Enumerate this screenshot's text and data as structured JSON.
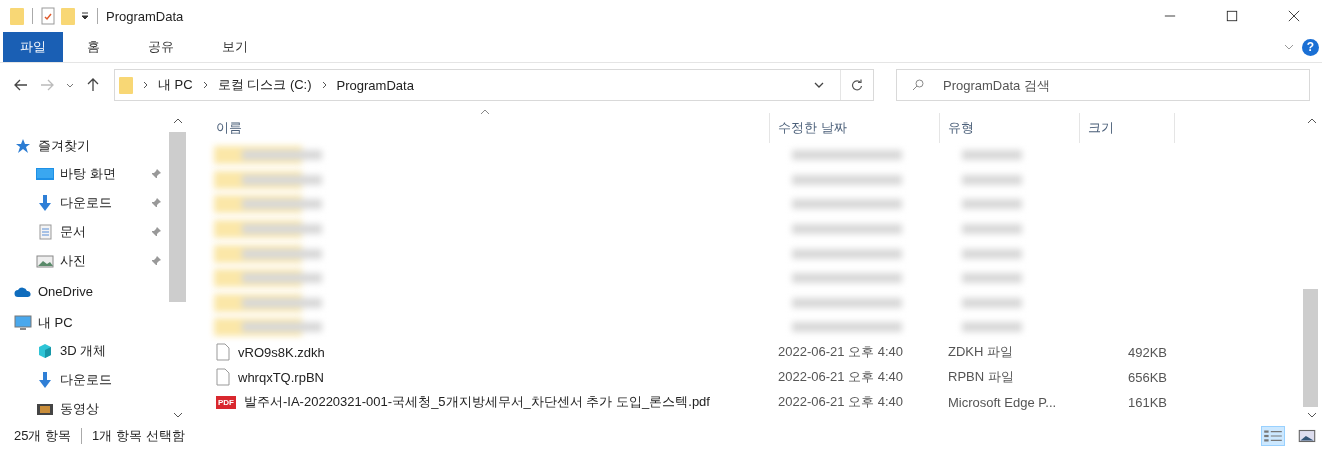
{
  "window": {
    "title": "ProgramData",
    "help_glyph": "?"
  },
  "ribbon_tabs": [
    {
      "label": "파일",
      "selected": true
    },
    {
      "label": "홈",
      "selected": false
    },
    {
      "label": "공유",
      "selected": false
    },
    {
      "label": "보기",
      "selected": false
    }
  ],
  "breadcrumb": [
    "내 PC",
    "로컬 디스크 (C:)",
    "ProgramData"
  ],
  "search": {
    "placeholder": "ProgramData 검색"
  },
  "sidebar": {
    "items": [
      {
        "label": "즐겨찾기",
        "kind": "star",
        "pinned": false,
        "children": [
          {
            "label": "바탕 화면",
            "kind": "desktop",
            "pinned": true
          },
          {
            "label": "다운로드",
            "kind": "download",
            "pinned": true
          },
          {
            "label": "문서",
            "kind": "document",
            "pinned": true
          },
          {
            "label": "사진",
            "kind": "pictures",
            "pinned": true
          }
        ]
      },
      {
        "label": "OneDrive",
        "kind": "cloud",
        "pinned": false
      },
      {
        "label": "내 PC",
        "kind": "pc",
        "pinned": false,
        "children": [
          {
            "label": "3D 개체",
            "kind": "cube",
            "pinned": false
          },
          {
            "label": "다운로드",
            "kind": "download",
            "pinned": false
          },
          {
            "label": "동영상",
            "kind": "video",
            "pinned": false
          }
        ]
      }
    ]
  },
  "table": {
    "columns": [
      "이름",
      "수정한 날짜",
      "유형",
      "크기"
    ],
    "rows": [
      {
        "kind": "blurred"
      },
      {
        "kind": "blurred"
      },
      {
        "kind": "blurred"
      },
      {
        "kind": "blurred"
      },
      {
        "kind": "blurred"
      },
      {
        "kind": "blurred"
      },
      {
        "kind": "blurred"
      },
      {
        "kind": "blurred"
      },
      {
        "kind": "file",
        "name": "vRO9s8K.zdkh",
        "date": "2022-06-21 오후 4:40",
        "type": "ZDKH 파일",
        "size": "492KB"
      },
      {
        "kind": "file",
        "name": "whrqxTQ.rpBN",
        "date": "2022-06-21 오후 4:40",
        "type": "RPBN 파일",
        "size": "656KB"
      },
      {
        "kind": "pdf",
        "pdf_label": "PDF",
        "name": "발주서-IA-20220321-001-국세청_5개지방세무서_차단센서 추가 도입_론스텍.pdf",
        "date": "2022-06-21 오후 4:40",
        "type": "Microsoft Edge P...",
        "size": "161KB"
      }
    ]
  },
  "status_bar": {
    "count": "25개 항목",
    "selection": "1개 항목 선택함"
  }
}
